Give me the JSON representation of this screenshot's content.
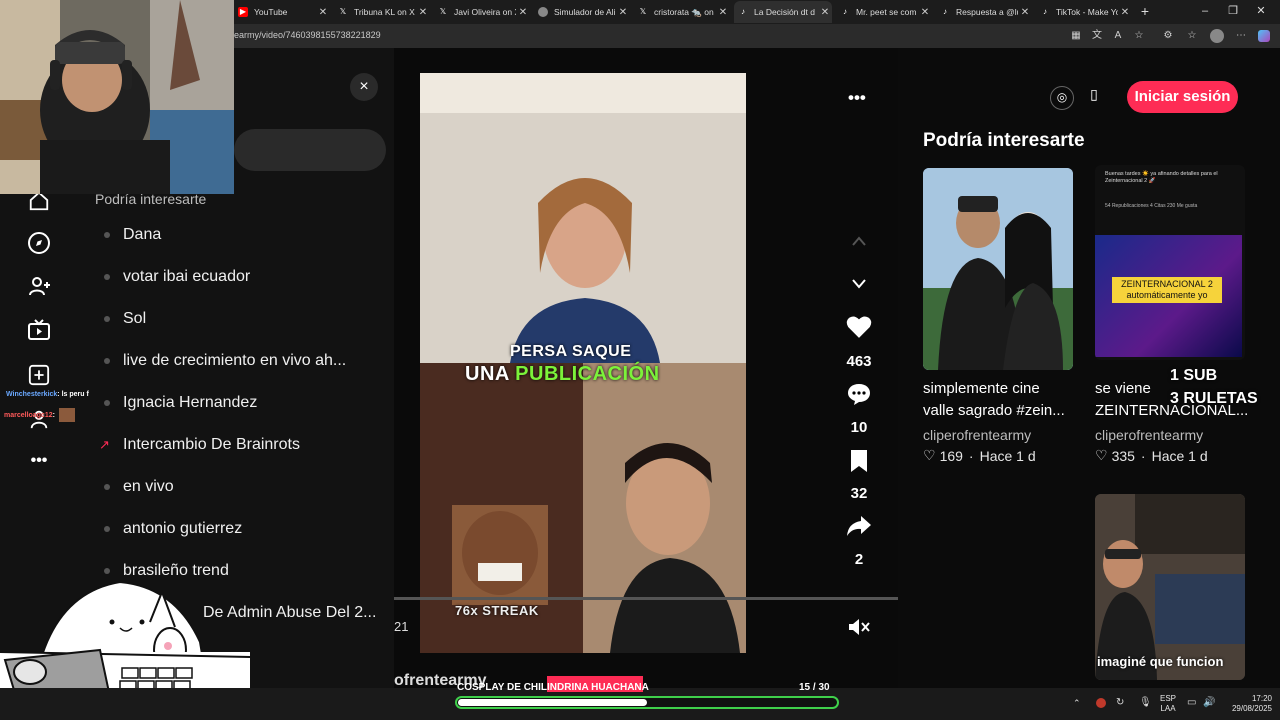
{
  "browser": {
    "tabs": [
      {
        "label": "YouTube",
        "icon": "youtube-icon"
      },
      {
        "label": "Tribuna KL on X",
        "icon": "x-logo-icon"
      },
      {
        "label": "Javi Oliveira on X",
        "icon": "x-logo-icon"
      },
      {
        "label": "Simulador de Ali",
        "icon": "globe-icon"
      },
      {
        "label": "cristorata 🐀 on",
        "icon": "x-logo-icon"
      },
      {
        "label": "La Decisión dt d",
        "icon": "tiktok-icon"
      },
      {
        "label": "Mr. peet se com",
        "icon": "tiktok-icon"
      },
      {
        "label": "Respuesta a @lu",
        "icon": "tiktok-icon"
      },
      {
        "label": "TikTok - Make Yo",
        "icon": "tiktok-icon"
      }
    ],
    "new_tab": "+",
    "url": "earmy/video/7460398155738221829"
  },
  "sidebar": {
    "close": "×",
    "section_title": "Podría interesarte",
    "items": [
      {
        "label": "Dana",
        "trending": false
      },
      {
        "label": "votar ibai ecuador",
        "trending": false
      },
      {
        "label": "Sol",
        "trending": false
      },
      {
        "label": "live de crecimiento en vivo ah...",
        "trending": false
      },
      {
        "label": "Ignacia Hernandez",
        "trending": false
      },
      {
        "label": "Intercambio De Brainrots",
        "trending": true
      },
      {
        "label": "en vivo",
        "trending": false
      },
      {
        "label": "antonio gutierrez",
        "trending": false
      },
      {
        "label": "brasileño trend",
        "trending": false
      },
      {
        "label": "De Admin Abuse Del 2...",
        "trending": false
      }
    ],
    "more": "•••"
  },
  "chat": [
    {
      "user": "Winchesterkick",
      "text": ": ls peru f"
    },
    {
      "user": "marcelloagc12",
      "text": ":"
    }
  ],
  "video": {
    "caption_line1": "PERSA SAQUE",
    "caption_line2a": "UNA ",
    "caption_line2b": "PUBLICACIÓN",
    "streak": "76x STREAK",
    "time_left": "21",
    "author_partial": "ofrentearmy",
    "more": "•••",
    "likes": "463",
    "comments": "10",
    "saves": "32",
    "shares": "2"
  },
  "header": {
    "login": "Iniciar sesión"
  },
  "recommendations": {
    "title": "Podría interesarte",
    "cards": [
      {
        "title_line1": "simplemente cine",
        "title_line2": "valle sagrado #zein...",
        "author": "cliperofrentearmy",
        "likes": "169",
        "age": "Hace 1 d"
      },
      {
        "title_line1": "se viene",
        "title_line2": "ZEINTERNACIONAL...",
        "author": "cliperofrentearmy",
        "likes": "335",
        "age": "Hace 1 d"
      }
    ],
    "thumb2_top_text": "Buenas tardes ☀️ ya afinando detalles para el Zeinternacional 2 🚀",
    "thumb2_stats": "54 Republicaciones  4 Citas  230 Me gusta",
    "thumb2_label_line1": "ZEINTERNACIONAL 2",
    "thumb2_label_line2": "automáticamente yo",
    "thumb3_caption": "imaginé que funcion"
  },
  "stream_overlay": {
    "sub_line1": "1 SUB",
    "sub_line2": "3 RULETAS",
    "goal_title": "COSPLAY DE CHILINDRINA HUACHANA",
    "goal_current": "15",
    "goal_total": "/ 30",
    "goal_fraction": 0.5
  },
  "taskbar": {
    "lang1": "ESP",
    "lang2": "LAA",
    "time": "17:20",
    "date": "29/08/2025"
  },
  "colors": {
    "accent": "#fe2c55",
    "caption_green": "#7cf23a",
    "goal_green": "#3fd04b"
  }
}
